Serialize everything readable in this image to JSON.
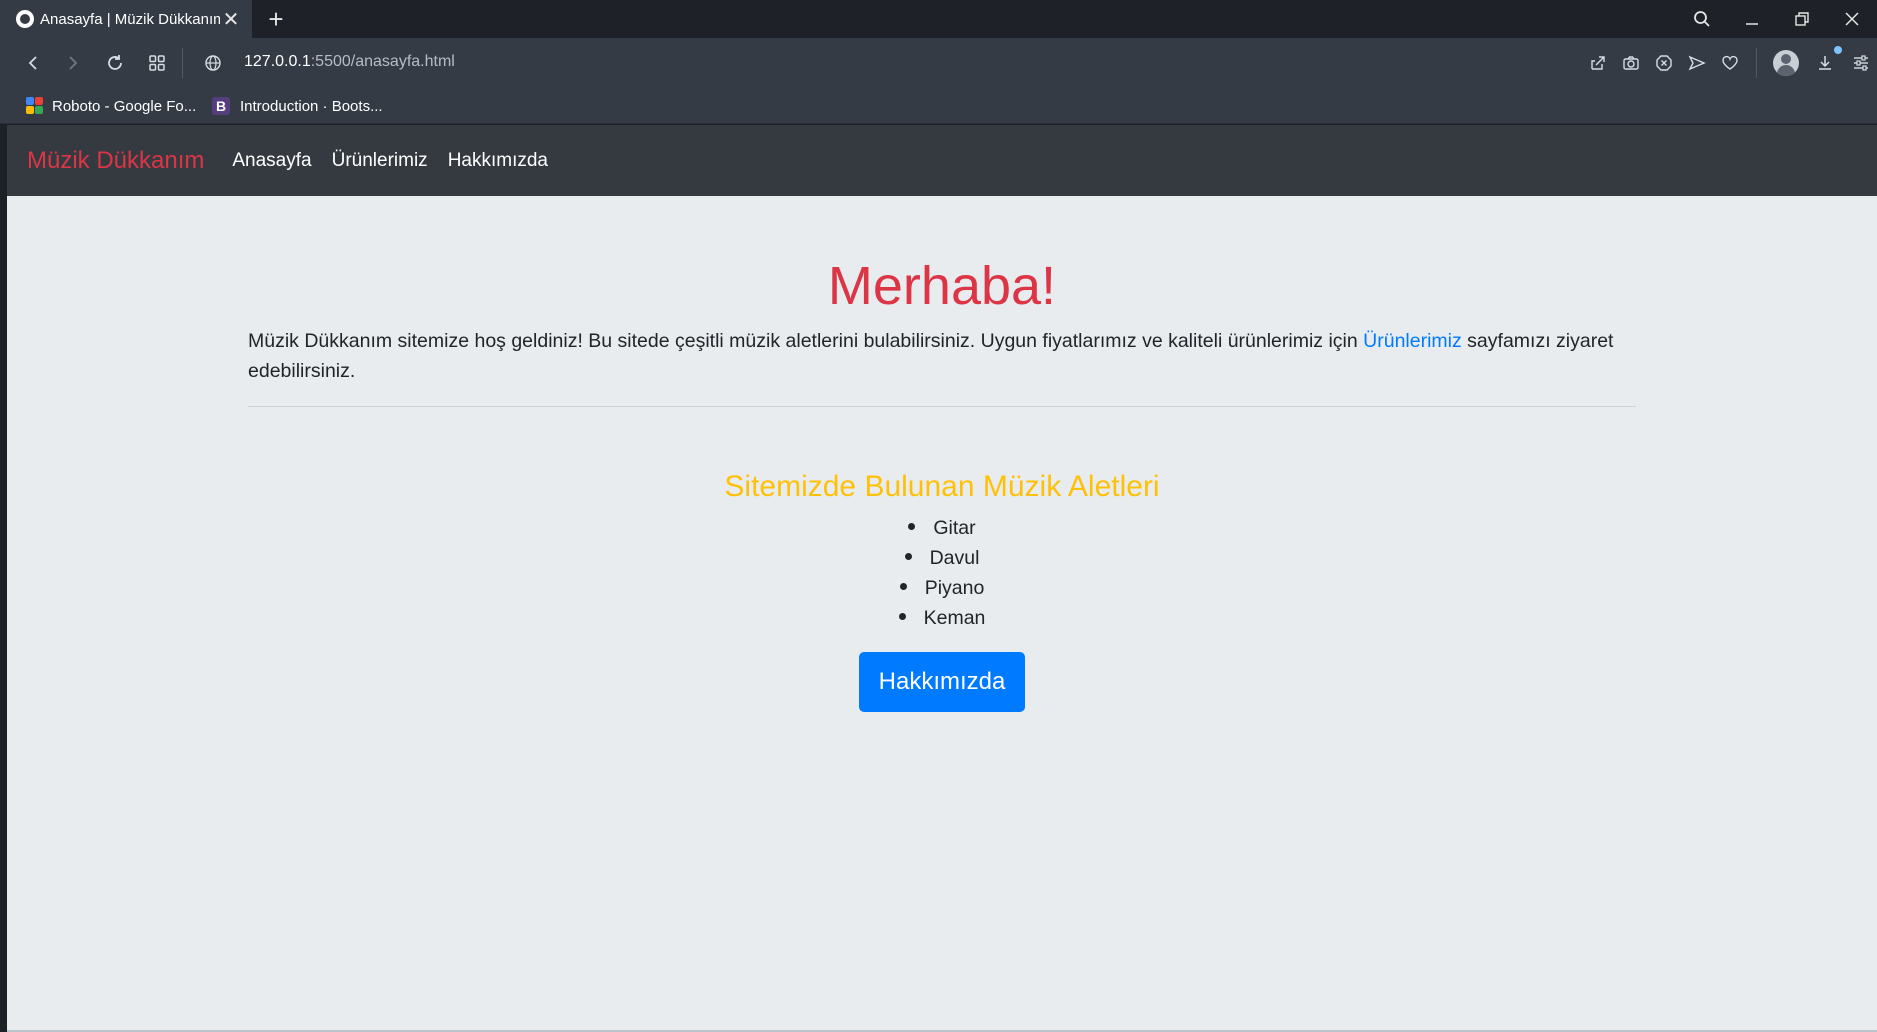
{
  "browser": {
    "tab_title": "Anasayfa | Müzik Dükkanım",
    "new_tab_symbol": "+",
    "tab_close_symbol": "✕",
    "url_host": "127.0.0.1",
    "url_rest": ":5500/anasayfa.html",
    "bookmarks": [
      {
        "label": "Roboto - Google Fo..."
      },
      {
        "label": "Introduction · Boots...",
        "icon_letter": "B"
      }
    ]
  },
  "site": {
    "brand": "Müzik Dükkanım",
    "nav": [
      "Anasayfa",
      "Ürünlerimiz",
      "Hakkımızda"
    ],
    "hero_title": "Merhaba!",
    "lead_before": "Müzik Dükkanım sitemize hoş geldiniz! Bu sitede çeşitli müzik aletlerini bulabilirsiniz. Uygun fiyatlarımız ve kaliteli ürünlerimiz için ",
    "lead_link": "Ürünlerimiz",
    "lead_after": " sayfamızı ziyaret edebilirsiniz.",
    "section_title": "Sitemizde Bulunan Müzik Aletleri",
    "instruments": [
      "Gitar",
      "Davul",
      "Piyano",
      "Keman"
    ],
    "button_label": "Hakkımızda"
  },
  "colors": {
    "brand_red": "#dc3545",
    "section_yellow": "#ffc107",
    "link_blue": "#007bff",
    "page_bg": "#e9ecef",
    "navbar_bg": "#343a40"
  }
}
